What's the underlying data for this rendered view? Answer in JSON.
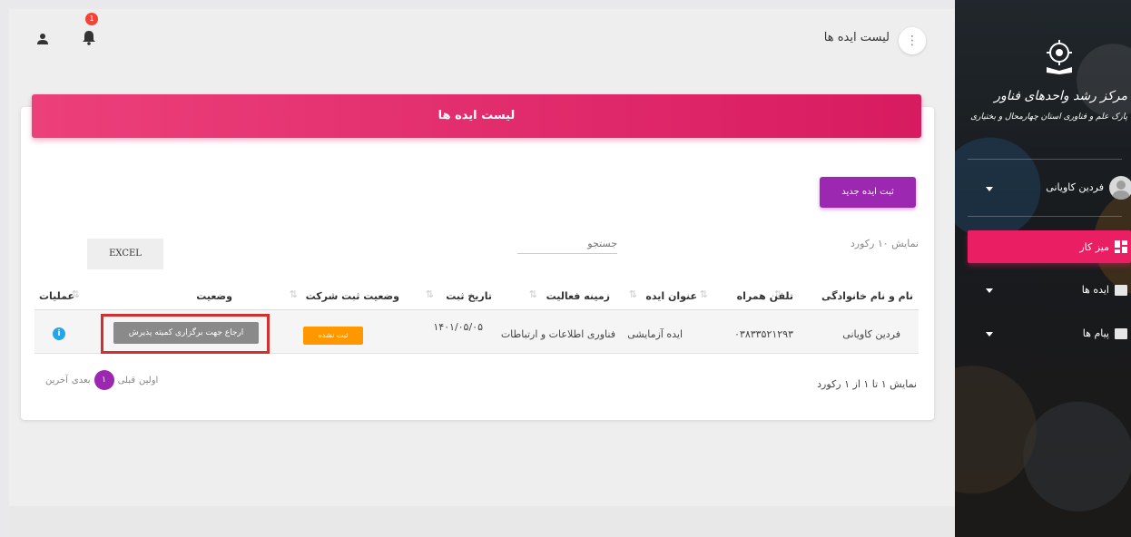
{
  "header": {
    "page_title": "لیست ایده ها",
    "notification_count": "1"
  },
  "card": {
    "title": "لیست ایده ها",
    "new_button": "ثبت ایده جدید",
    "show_records_label": "نمایش ۱۰ رکورد",
    "search_placeholder": "جستجو",
    "excel_button": "EXCEL"
  },
  "table": {
    "headers": {
      "name": "نام و نام خانوادگی",
      "phone": "تلفن همراه",
      "idea_title": "عنوان ایده",
      "field": "زمینه فعالیت",
      "date": "تاریخ ثبت",
      "company_status": "وضعیت ثبت شرکت",
      "status": "وضعیت",
      "actions": "عملیات"
    },
    "rows": [
      {
        "name": "فردین کاویانی",
        "phone": "۰۳۸۳۳۵۲۱۲۹۳",
        "idea_title": "ایده آزمایشی",
        "field": "فناوری اطلاعات و ارتباطات",
        "date": "۱۴۰۱/۰۵/۰۵",
        "company_status": "ثبت نشده",
        "status": "ارجاع جهت برگزاری کمیته پذیرش"
      }
    ]
  },
  "pagination": {
    "summary": "نمایش ۱ تا ۱ از ۱ رکورد",
    "first": "اولین",
    "prev": "قبلی",
    "current": "۱",
    "next": "بعدی",
    "last": "آخرین"
  },
  "sidebar": {
    "logo_title": "مرکز رشد واحدهای فناور",
    "logo_subtitle": "پارک علم و فناوری استان چهارمحال و بختیاری",
    "user_name": "فردین کاویانی",
    "items": [
      {
        "label": "میز کار"
      },
      {
        "label": "ایده ها"
      },
      {
        "label": "پیام ها"
      }
    ]
  },
  "colors": {
    "accent_pink": "#e91e63",
    "accent_purple": "#9c27b0",
    "status_orange": "#ff9800",
    "highlight_red": "#d32f2f"
  }
}
